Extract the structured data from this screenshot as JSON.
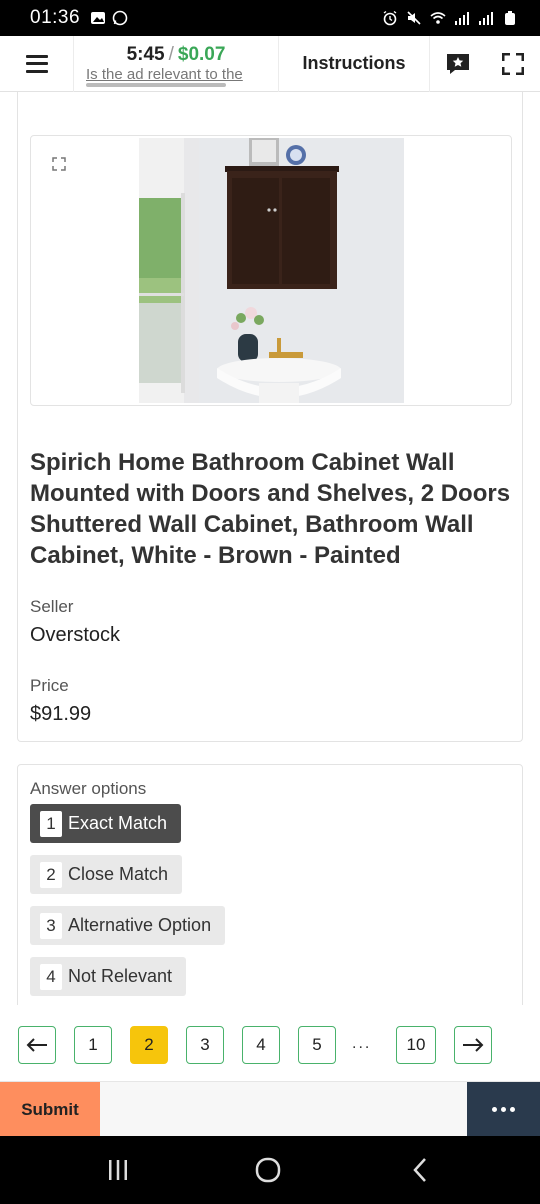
{
  "status_bar": {
    "time": "01:36",
    "left_icons": [
      "image-icon",
      "whatsapp-icon"
    ],
    "right_icons": [
      "alarm-icon",
      "mute-icon",
      "wifi-icon",
      "signal-icon",
      "signal-icon",
      "battery-icon"
    ]
  },
  "header": {
    "timer": "5:45",
    "separator": "/",
    "reward": "$0.07",
    "question": "Is the ad relevant to the",
    "instructions_label": "Instructions",
    "icons": [
      "hamburger-menu-icon",
      "star-comment-icon",
      "fullscreen-icon"
    ],
    "timer_progress": 0.78
  },
  "task": {
    "image_alt": "Dark brown wall cabinet above a white pedestal sink",
    "product_title": "Spirich Home Bathroom Cabinet Wall Mounted with Doors and Shelves, 2 Doors Shuttered Wall Cabinet, Bathroom Wall Cabinet, White - Brown - Painted",
    "seller_label": "Seller",
    "seller_value": "Overstock",
    "price_label": "Price",
    "price_value": "$91.99"
  },
  "answers": {
    "title": "Answer options",
    "options": [
      {
        "key": "1",
        "label": "Exact Match",
        "selected": true
      },
      {
        "key": "2",
        "label": "Close Match",
        "selected": false
      },
      {
        "key": "3",
        "label": "Alternative Option",
        "selected": false
      },
      {
        "key": "4",
        "label": "Not Relevant",
        "selected": false
      }
    ]
  },
  "pagination": {
    "prev_icon": "arrow-left-icon",
    "next_icon": "arrow-right-icon",
    "pages": [
      "1",
      "2",
      "3",
      "4",
      "5"
    ],
    "ellipsis": "...",
    "last_page": "10",
    "current_page": "2"
  },
  "actions": {
    "submit_label": "Submit",
    "more_icon": "more-dots-icon"
  },
  "system_nav": [
    "recents-icon",
    "home-icon",
    "back-icon"
  ],
  "colors": {
    "reward_green": "#3aa757",
    "page_border_green": "#49b26b",
    "current_page_yellow": "#f6c50c",
    "submit_orange": "#fe8e5e",
    "more_navy": "#2a3a4d",
    "selected_option": "#4c4c4c"
  }
}
